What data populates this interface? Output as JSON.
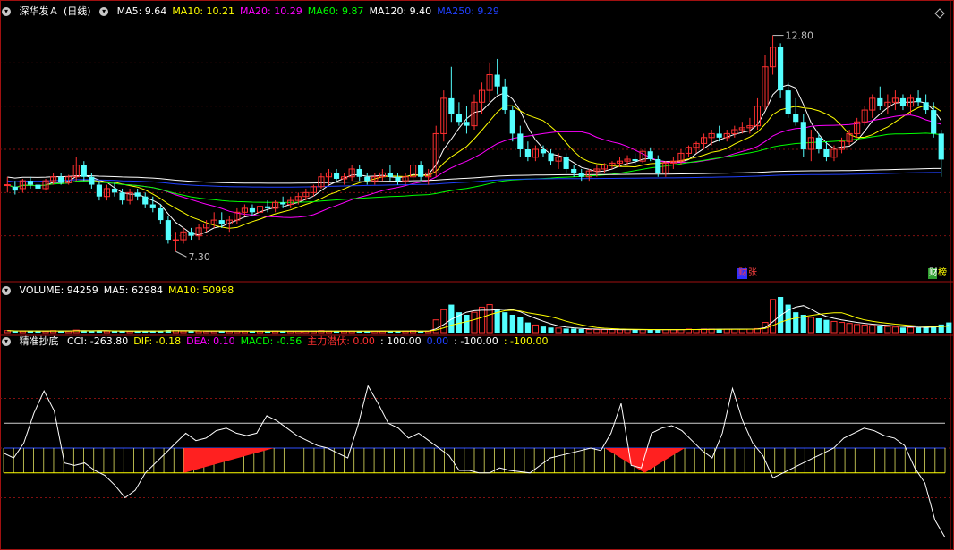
{
  "header_price": {
    "stock": "深华发Ａ",
    "period": "(日线)",
    "ma": [
      {
        "label": "MA5: 9.64",
        "color": "#ffffff"
      },
      {
        "label": "MA10: 10.21",
        "color": "#ffff00"
      },
      {
        "label": "MA20: 10.29",
        "color": "#ff00ff"
      },
      {
        "label": "MA60: 9.87",
        "color": "#00ff00"
      },
      {
        "label": "MA120: 9.40",
        "color": "#ffffff"
      },
      {
        "label": "MA250: 9.29",
        "color": "#2040ff"
      }
    ]
  },
  "header_volume": {
    "items": [
      {
        "label": "VOLUME: 94259",
        "color": "#ffffff"
      },
      {
        "label": "MA5: 62984",
        "color": "#ffffff"
      },
      {
        "label": "MA10: 50998",
        "color": "#ffff00"
      }
    ]
  },
  "header_indicator": {
    "name": "精准抄底",
    "items": [
      {
        "label": "CCI: -263.80",
        "color": "#ffffff"
      },
      {
        "label": "DIF: -0.18",
        "color": "#ffff00"
      },
      {
        "label": "DEA: 0.10",
        "color": "#ff00ff"
      },
      {
        "label": "MACD: -0.56",
        "color": "#00ff00"
      },
      {
        "label": "主力潜伏: 0.00",
        "color": "#ff3030"
      },
      {
        "label": ": 100.00",
        "color": "#ffffff"
      },
      {
        "label": "0.00",
        "color": "#2040ff"
      },
      {
        "label": ": -100.00",
        "color": "#ffffff"
      },
      {
        "label": ": -100.00",
        "color": "#ffff00"
      }
    ]
  },
  "badges": [
    {
      "text": "财",
      "color": "#ff4040",
      "bg": "#3030ff"
    },
    {
      "text": "张",
      "color": "#ff4040",
      "bg": "#000000"
    },
    {
      "text": "财",
      "color": "#ffffff",
      "bg": "#30a030"
    },
    {
      "text": "榜",
      "color": "#ffff00",
      "bg": "#000000"
    }
  ],
  "chart_data": {
    "type": "candlestick",
    "annotations": {
      "high_label": "12.80",
      "low_label": "7.30"
    },
    "price_range": [
      6.6,
      13.2
    ],
    "candles": [
      [
        9.0,
        9.2,
        8.8,
        9.0
      ],
      [
        8.95,
        9.1,
        8.75,
        8.85
      ],
      [
        8.9,
        9.15,
        8.8,
        9.1
      ],
      [
        9.1,
        9.2,
        8.9,
        9.0
      ],
      [
        9.0,
        9.1,
        8.8,
        8.9
      ],
      [
        8.9,
        9.15,
        8.85,
        9.1
      ],
      [
        9.1,
        9.3,
        9.0,
        9.2
      ],
      [
        9.2,
        9.3,
        9.0,
        9.05
      ],
      [
        9.05,
        9.25,
        9.0,
        9.2
      ],
      [
        9.2,
        9.7,
        9.1,
        9.5
      ],
      [
        9.5,
        9.6,
        9.1,
        9.2
      ],
      [
        9.2,
        9.3,
        8.9,
        9.0
      ],
      [
        9.0,
        9.1,
        8.6,
        8.7
      ],
      [
        8.7,
        9.0,
        8.6,
        8.9
      ],
      [
        8.9,
        9.05,
        8.7,
        8.8
      ],
      [
        8.8,
        8.9,
        8.5,
        8.6
      ],
      [
        8.6,
        8.9,
        8.5,
        8.8
      ],
      [
        8.8,
        8.9,
        8.6,
        8.7
      ],
      [
        8.7,
        8.8,
        8.4,
        8.5
      ],
      [
        8.5,
        8.7,
        8.3,
        8.4
      ],
      [
        8.4,
        8.5,
        8.0,
        8.1
      ],
      [
        8.1,
        8.2,
        7.5,
        7.6
      ],
      [
        7.6,
        7.8,
        7.3,
        7.6
      ],
      [
        7.6,
        7.9,
        7.5,
        7.8
      ],
      [
        7.8,
        7.9,
        7.6,
        7.7
      ],
      [
        7.7,
        8.0,
        7.6,
        7.9
      ],
      [
        7.9,
        8.1,
        7.8,
        8.0
      ],
      [
        8.0,
        8.3,
        7.9,
        8.1
      ],
      [
        8.1,
        8.3,
        7.9,
        8.0
      ],
      [
        8.0,
        8.2,
        7.8,
        8.1
      ],
      [
        8.1,
        8.4,
        8.0,
        8.3
      ],
      [
        8.3,
        8.5,
        8.2,
        8.4
      ],
      [
        8.4,
        8.5,
        8.2,
        8.3
      ],
      [
        8.3,
        8.5,
        8.2,
        8.45
      ],
      [
        8.45,
        8.6,
        8.3,
        8.4
      ],
      [
        8.4,
        8.6,
        8.3,
        8.55
      ],
      [
        8.55,
        8.7,
        8.4,
        8.5
      ],
      [
        8.5,
        8.7,
        8.4,
        8.6
      ],
      [
        8.6,
        8.8,
        8.5,
        8.7
      ],
      [
        8.7,
        8.9,
        8.6,
        8.8
      ],
      [
        8.8,
        9.0,
        8.7,
        8.95
      ],
      [
        8.95,
        9.3,
        8.9,
        9.2
      ],
      [
        9.2,
        9.4,
        9.0,
        9.3
      ],
      [
        9.3,
        9.4,
        9.1,
        9.15
      ],
      [
        9.15,
        9.3,
        9.0,
        9.2
      ],
      [
        9.2,
        9.5,
        9.1,
        9.4
      ],
      [
        9.4,
        9.5,
        9.1,
        9.2
      ],
      [
        9.2,
        9.3,
        9.0,
        9.1
      ],
      [
        9.1,
        9.3,
        9.0,
        9.2
      ],
      [
        9.2,
        9.4,
        9.1,
        9.3
      ],
      [
        9.3,
        9.5,
        9.1,
        9.2
      ],
      [
        9.2,
        9.3,
        9.0,
        9.1
      ],
      [
        9.1,
        9.3,
        9.0,
        9.2
      ],
      [
        9.2,
        9.6,
        9.0,
        9.5
      ],
      [
        9.5,
        9.6,
        9.1,
        9.2
      ],
      [
        9.2,
        9.4,
        9.0,
        9.3
      ],
      [
        9.3,
        10.5,
        9.2,
        10.3
      ],
      [
        10.3,
        11.4,
        10.1,
        11.2
      ],
      [
        11.2,
        12.0,
        10.6,
        10.8
      ],
      [
        10.8,
        11.1,
        10.5,
        10.6
      ],
      [
        10.6,
        11.0,
        10.3,
        10.5
      ],
      [
        10.5,
        11.3,
        10.4,
        11.1
      ],
      [
        11.1,
        11.6,
        10.8,
        11.4
      ],
      [
        11.4,
        12.1,
        11.1,
        11.8
      ],
      [
        11.8,
        12.2,
        11.3,
        11.5
      ],
      [
        11.5,
        11.7,
        10.8,
        10.9
      ],
      [
        10.9,
        11.0,
        10.1,
        10.3
      ],
      [
        10.3,
        10.5,
        9.7,
        9.9
      ],
      [
        9.9,
        10.1,
        9.6,
        9.7
      ],
      [
        9.7,
        10.0,
        9.6,
        9.9
      ],
      [
        9.9,
        10.0,
        9.7,
        9.8
      ],
      [
        9.8,
        9.9,
        9.5,
        9.6
      ],
      [
        9.6,
        9.8,
        9.4,
        9.7
      ],
      [
        9.7,
        9.8,
        9.3,
        9.4
      ],
      [
        9.4,
        9.5,
        9.2,
        9.3
      ],
      [
        9.3,
        9.4,
        9.1,
        9.2
      ],
      [
        9.2,
        9.4,
        9.1,
        9.35
      ],
      [
        9.35,
        9.5,
        9.2,
        9.4
      ],
      [
        9.4,
        9.55,
        9.3,
        9.5
      ],
      [
        9.5,
        9.6,
        9.4,
        9.55
      ],
      [
        9.55,
        9.7,
        9.45,
        9.6
      ],
      [
        9.6,
        9.75,
        9.5,
        9.65
      ],
      [
        9.65,
        9.8,
        9.5,
        9.6
      ],
      [
        9.6,
        9.9,
        9.55,
        9.85
      ],
      [
        9.85,
        9.95,
        9.6,
        9.65
      ],
      [
        9.65,
        9.75,
        9.2,
        9.3
      ],
      [
        9.3,
        9.6,
        9.2,
        9.55
      ],
      [
        9.55,
        9.7,
        9.4,
        9.6
      ],
      [
        9.6,
        9.9,
        9.5,
        9.8
      ],
      [
        9.8,
        10.0,
        9.7,
        9.95
      ],
      [
        9.95,
        10.1,
        9.8,
        10.05
      ],
      [
        10.05,
        10.3,
        9.9,
        10.2
      ],
      [
        10.2,
        10.4,
        10.0,
        10.3
      ],
      [
        10.3,
        10.5,
        10.1,
        10.2
      ],
      [
        10.2,
        10.4,
        10.1,
        10.3
      ],
      [
        10.3,
        10.5,
        10.2,
        10.4
      ],
      [
        10.4,
        10.6,
        10.3,
        10.45
      ],
      [
        10.45,
        10.7,
        10.3,
        10.5
      ],
      [
        10.5,
        11.2,
        10.4,
        11.0
      ],
      [
        11.0,
        12.3,
        10.9,
        12.0
      ],
      [
        12.0,
        12.8,
        11.8,
        12.5
      ],
      [
        12.5,
        12.6,
        11.2,
        11.4
      ],
      [
        11.4,
        11.6,
        10.7,
        10.8
      ],
      [
        10.8,
        11.2,
        10.5,
        10.6
      ],
      [
        10.6,
        10.8,
        9.7,
        9.9
      ],
      [
        9.9,
        10.4,
        9.6,
        10.2
      ],
      [
        10.2,
        10.3,
        9.8,
        9.9
      ],
      [
        9.9,
        10.1,
        9.6,
        9.7
      ],
      [
        9.7,
        10.0,
        9.6,
        9.9
      ],
      [
        9.9,
        10.2,
        9.8,
        10.1
      ],
      [
        10.1,
        10.4,
        10.0,
        10.3
      ],
      [
        10.3,
        10.7,
        10.2,
        10.6
      ],
      [
        10.6,
        11.0,
        10.5,
        10.9
      ],
      [
        10.9,
        11.3,
        10.7,
        11.2
      ],
      [
        11.2,
        11.5,
        10.9,
        11.0
      ],
      [
        11.0,
        11.3,
        10.8,
        11.1
      ],
      [
        11.1,
        11.4,
        10.9,
        11.2
      ],
      [
        11.2,
        11.3,
        10.9,
        11.0
      ],
      [
        11.0,
        11.3,
        10.8,
        11.2
      ],
      [
        11.2,
        11.4,
        11.0,
        11.1
      ],
      [
        11.1,
        11.3,
        10.8,
        10.9
      ],
      [
        10.9,
        11.1,
        10.2,
        10.3
      ],
      [
        10.3,
        10.4,
        9.2,
        9.64
      ]
    ],
    "volume_range": [
      0,
      100000
    ],
    "volume": [
      4,
      3,
      3,
      3,
      4,
      3,
      4,
      3,
      3,
      5,
      4,
      3,
      4,
      3,
      3,
      3,
      3,
      3,
      3,
      4,
      4,
      5,
      4,
      3,
      3,
      3,
      3,
      3,
      3,
      3,
      3,
      3,
      3,
      3,
      3,
      3,
      3,
      3,
      3,
      3,
      3,
      4,
      3,
      3,
      3,
      3,
      3,
      3,
      3,
      3,
      3,
      3,
      3,
      4,
      3,
      3,
      25,
      45,
      55,
      40,
      35,
      40,
      50,
      55,
      45,
      40,
      35,
      30,
      20,
      15,
      12,
      10,
      9,
      8,
      8,
      7,
      6,
      6,
      6,
      6,
      6,
      6,
      6,
      6,
      6,
      6,
      6,
      6,
      6,
      7,
      6,
      7,
      7,
      7,
      7,
      7,
      7,
      7,
      8,
      20,
      65,
      70,
      55,
      40,
      35,
      30,
      28,
      25,
      22,
      20,
      18,
      16,
      15,
      14,
      14,
      12,
      11,
      10,
      10,
      10,
      11,
      13,
      16,
      20
    ],
    "indicator_range": [
      -400,
      400
    ],
    "cci_ref_lines": [
      100,
      0,
      -100
    ],
    "cci": [
      -20,
      -40,
      20,
      140,
      230,
      150,
      -60,
      -70,
      -60,
      -90,
      -110,
      -150,
      -200,
      -170,
      -100,
      -60,
      -20,
      20,
      60,
      30,
      40,
      70,
      80,
      60,
      50,
      60,
      130,
      110,
      80,
      50,
      30,
      10,
      0,
      -20,
      -40,
      90,
      250,
      180,
      100,
      80,
      40,
      60,
      30,
      0,
      -30,
      -90,
      -90,
      -100,
      -100,
      -80,
      -90,
      -95,
      -100,
      -70,
      -40,
      -30,
      -20,
      -10,
      0,
      -10,
      60,
      180,
      -70,
      -80,
      60,
      80,
      90,
      70,
      30,
      -10,
      -40,
      60,
      240,
      110,
      20,
      -30,
      -120,
      -100,
      -80,
      -60,
      -40,
      -20,
      0,
      40,
      60,
      80,
      70,
      50,
      40,
      10,
      -80,
      -140,
      -290,
      -360
    ]
  }
}
